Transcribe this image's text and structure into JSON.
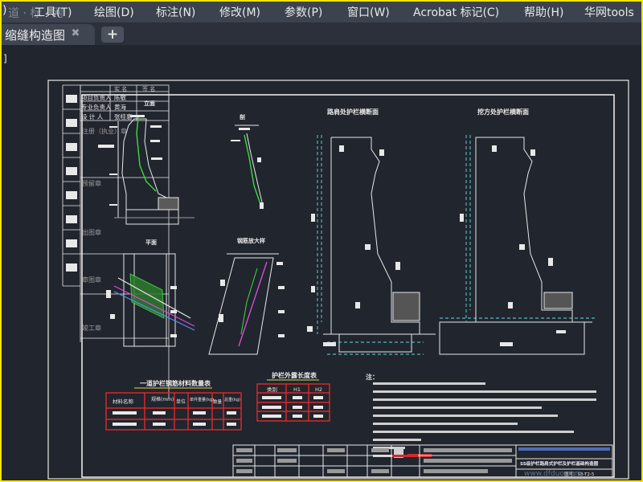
{
  "menu": {
    "items": [
      ")",
      "工具(T)",
      "绘图(D)",
      "标注(N)",
      "修改(M)",
      "参数(P)",
      "窗口(W)",
      "Acrobat 标记(C)",
      "帮助(H)",
      "华网tools"
    ],
    "watermark": "道 · 标 · 网"
  },
  "tabs": {
    "active_label": "缩缝构造图",
    "close_glyph": "✖",
    "new_tab_glyph": "+"
  },
  "canvas": {
    "left_edge_mark": "]",
    "drawing": {
      "sign_table": {
        "headers": [
          "实 名",
          "签 名"
        ],
        "rows": [
          {
            "role": "项目负责人",
            "name": "陈敏"
          },
          {
            "role": "专业负责人",
            "name": "黄海"
          },
          {
            "role": "设 计 人",
            "name": "张桂惠"
          }
        ],
        "side_labels": [
          "注册（执业）章",
          "预留章",
          "出图章",
          "审图章",
          "竣工章"
        ]
      },
      "views": {
        "section_a": "立面",
        "section_b": "剖",
        "plan": "平面",
        "rebar_detail": "钢筋放大样",
        "wall_left": "路肩处护栏横断面",
        "wall_right": "挖方处护栏横断面"
      },
      "tables": {
        "material_title": "一道护栏钢筋材料数量表",
        "material_headers": [
          "材料名称",
          "规格(mm)",
          "单位",
          "单件重量(kg)",
          "数量",
          "总重(kg)"
        ],
        "length_title": "护栏外露长度表",
        "length_headers": [
          "类别",
          "H1",
          "H2"
        ]
      },
      "notes_title": "注：",
      "title_block": {
        "title_main": "SS级护栏路肩式护栏及护栏基础构造图",
        "drawing_no": "图号：S3-T2-5"
      },
      "footer_watermark": "www.dfduo.com"
    }
  },
  "colors": {
    "frame_border": "#f2e600",
    "menubar_bg": "#3c434e",
    "canvas_bg": "#21252e",
    "line_white": "#e8e8e8",
    "line_green": "#3ddc3d",
    "line_magenta": "#d64bd6",
    "line_cyan": "#5ee0e0",
    "table_red": "#d42a2a",
    "line_yellow": "#e2d84a"
  }
}
